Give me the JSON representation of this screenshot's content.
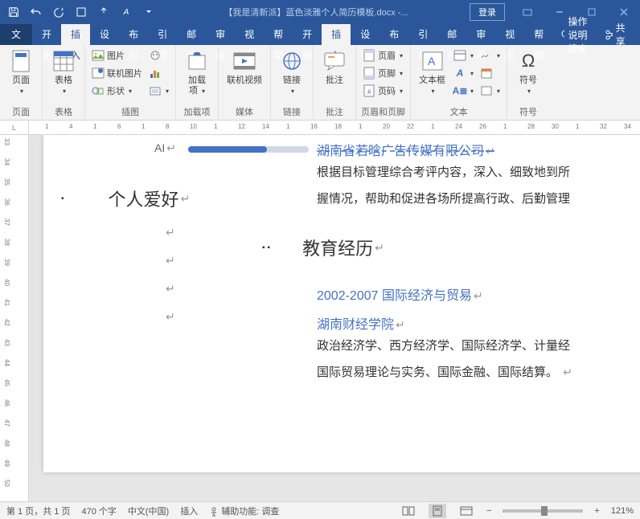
{
  "titlebar": {
    "doc_title": "【我是清新派】蓝色淡雅个人简历模板.docx -...",
    "login": "登录"
  },
  "menu": {
    "file": "文件",
    "tabs": [
      "开始",
      "插入",
      "设计",
      "布局",
      "引用",
      "邮件",
      "审阅",
      "视图",
      "帮助"
    ],
    "active_index": 1,
    "tell_me": "操作说明搜索",
    "share": "共享"
  },
  "ribbon": {
    "pages": {
      "cover": "页面",
      "label": "页面"
    },
    "table": {
      "btn": "表格",
      "label": "表格"
    },
    "illus": {
      "pic": "图片",
      "online_pic": "联机图片",
      "shapes": "形状",
      "label": "插图"
    },
    "addins": {
      "btn": "加载\n项",
      "label": "加载项"
    },
    "media": {
      "btn": "联机视频",
      "label": "媒体"
    },
    "link": {
      "btn": "链接",
      "label": "链接"
    },
    "comment": {
      "btn": "批注",
      "label": "批注"
    },
    "hf": {
      "header": "页眉",
      "footer": "页脚",
      "pagenum": "页码",
      "label": "页眉和页脚"
    },
    "text": {
      "textbox": "文本框",
      "label": "文本"
    },
    "symbol": {
      "btn": "符号",
      "label": "符号"
    }
  },
  "ruler": {
    "corner": "L",
    "h_ticks": [
      "1",
      "4",
      "1",
      "6",
      "1",
      "8",
      "10",
      "1",
      "12",
      "14",
      "1",
      "16",
      "18",
      "1",
      "20",
      "22",
      "1",
      "24",
      "26",
      "1",
      "28",
      "30",
      "1",
      "32",
      "34"
    ],
    "v_ticks": [
      "33",
      "34",
      "35",
      "36",
      "37",
      "38",
      "39",
      "40",
      "41",
      "42",
      "43",
      "44",
      "45",
      "46",
      "47",
      "48",
      "49",
      "50"
    ]
  },
  "doc": {
    "left": {
      "ai": "AI",
      "skill_percent": 65,
      "heading": "个人爱好",
      "markers": [
        "↵",
        "↵",
        "↵",
        "↵"
      ]
    },
    "right": {
      "company": "湖南省若晗广告传媒有限公司",
      "p1": "根据目标管理综合考评内容，深入、细致地到所",
      "p2": "握情况，帮助和促进各场所提高行政、后勤管理",
      "heading": "教育经历",
      "edu_date": "2002-2007 国际经济与贸易",
      "school": "湖南财经学院",
      "courses1": "政治经济学、西方经济学、国际经济学、计量经",
      "courses2": "国际贸易理论与实务、国际金融、国际结算。"
    }
  },
  "status": {
    "page": "第 1 页，共 1 页",
    "words": "470 个字",
    "lang": "中文(中国)",
    "mode": "插入",
    "a11y": "辅助功能: 调查",
    "zoom": "121%"
  }
}
